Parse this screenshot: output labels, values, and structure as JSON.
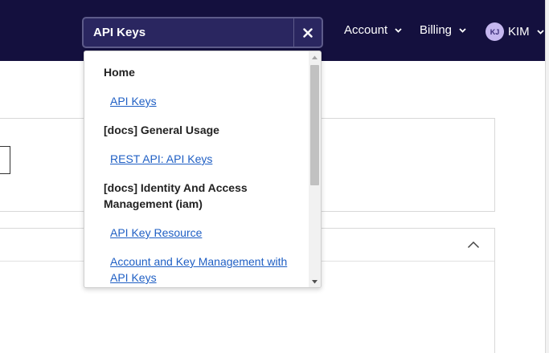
{
  "header": {
    "search": {
      "value": "API Keys",
      "placeholder": ""
    },
    "nav": {
      "account_label": "Account",
      "billing_label": "Billing",
      "user_initials": "KJ",
      "user_name": "KIM"
    }
  },
  "search_results": {
    "groups": [
      {
        "title": "Home",
        "links": [
          "API Keys"
        ]
      },
      {
        "title": "[docs] General Usage",
        "links": [
          "REST API: API Keys"
        ]
      },
      {
        "title": "[docs] Identity And Access Management (iam)",
        "links": [
          "API Key Resource",
          "Account and Key Management with API Keys"
        ]
      }
    ]
  },
  "colors": {
    "header_bg": "#14103e",
    "search_bg": "#2a2660",
    "link": "#1f5fc4",
    "avatar_bg": "#c5b7ef"
  },
  "icons": {
    "clear": "close-icon",
    "account_chevron": "chevron-down-icon",
    "billing_chevron": "chevron-down-icon",
    "user_chevron": "chevron-down-icon",
    "panel_toggle": "chevron-up-icon"
  }
}
